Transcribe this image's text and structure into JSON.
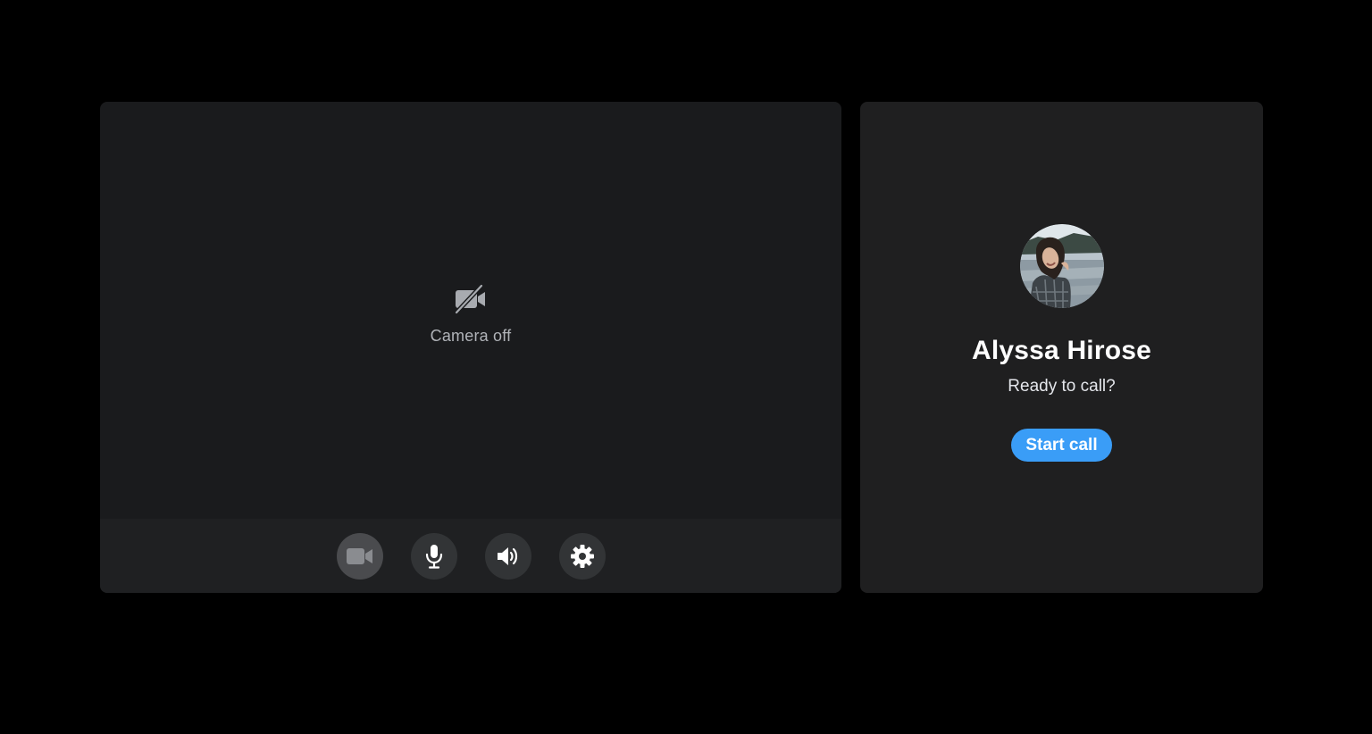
{
  "preview": {
    "camera_status": "Camera off",
    "camera_status_icon": "video-off-icon"
  },
  "controls": [
    {
      "icon": "video-camera-icon",
      "active": true
    },
    {
      "icon": "microphone-icon",
      "active": false
    },
    {
      "icon": "speaker-icon",
      "active": false
    },
    {
      "icon": "gear-icon",
      "active": false
    }
  ],
  "contact": {
    "name": "Alyssa Hirose",
    "status": "Ready to call?",
    "start_call_label": "Start call",
    "avatar_icon": "profile-photo"
  },
  "colors": {
    "background": "#000000",
    "panel": "#1a1b1d",
    "accent": "#3a9df7"
  }
}
